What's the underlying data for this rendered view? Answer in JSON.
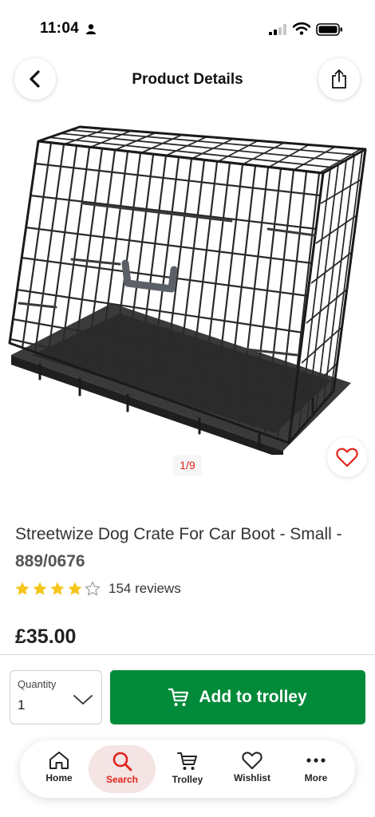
{
  "status_bar": {
    "time": "11:04"
  },
  "header": {
    "title": "Product Details"
  },
  "gallery": {
    "counter": "1/9"
  },
  "product": {
    "title": "Streetwize Dog Crate For Car Boot - Small",
    "title_separator": " - ",
    "code": "889/0676",
    "rating": 4,
    "rating_max": 5,
    "reviews": "154 reviews",
    "price": "£35.00"
  },
  "purchase": {
    "quantity_label": "Quantity",
    "quantity_value": "1",
    "add_to_trolley": "Add to trolley"
  },
  "nav": {
    "items": [
      {
        "label": "Home",
        "icon": "home-icon"
      },
      {
        "label": "Search",
        "icon": "search-icon",
        "active": true
      },
      {
        "label": "Trolley",
        "icon": "trolley-icon"
      },
      {
        "label": "Wishlist",
        "icon": "heart-icon"
      },
      {
        "label": "More",
        "icon": "more-icon"
      }
    ]
  },
  "colors": {
    "accent_red": "#e2231a",
    "button_green": "#008a39",
    "star_yellow": "#f5c518"
  }
}
